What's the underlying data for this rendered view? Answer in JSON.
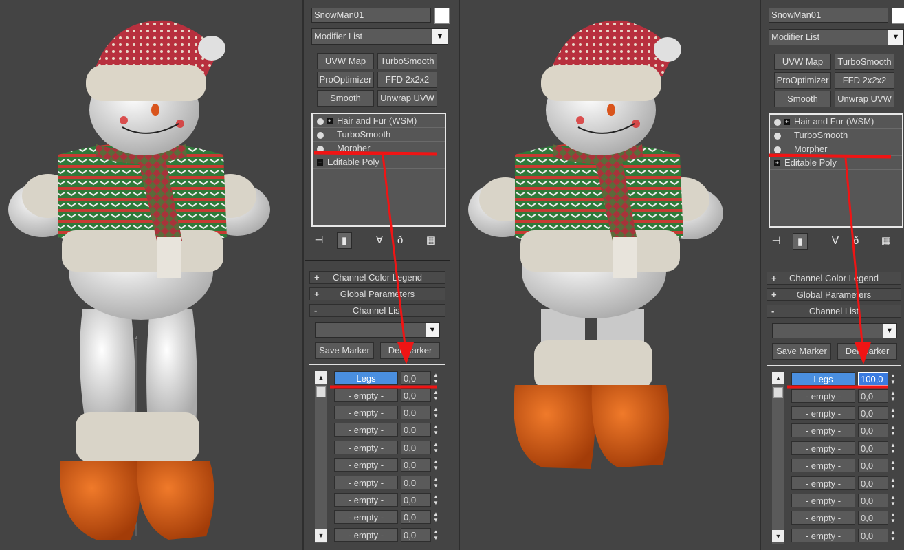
{
  "left": {
    "object_name": "SnowMan01",
    "modifier_list": "Modifier List",
    "buttons": [
      "UVW Map",
      "TurboSmooth",
      "ProOptimizer",
      "FFD 2x2x2",
      "Smooth",
      "Unwrap UVW"
    ],
    "stack": [
      "Hair and Fur (WSM)",
      "TurboSmooth",
      "Morpher",
      "Editable Poly"
    ],
    "rollouts": {
      "legend": "Channel Color Legend",
      "global": "Global Parameters",
      "channel": "Channel List"
    },
    "save_marker": "Save Marker",
    "del_marker": "Del Marker",
    "channels": [
      {
        "name": "Legs",
        "value": "0,0"
      },
      {
        "name": "- empty -",
        "value": "0,0"
      },
      {
        "name": "- empty -",
        "value": "0,0"
      },
      {
        "name": "- empty -",
        "value": "0,0"
      },
      {
        "name": "- empty -",
        "value": "0,0"
      },
      {
        "name": "- empty -",
        "value": "0,0"
      },
      {
        "name": "- empty -",
        "value": "0,0"
      },
      {
        "name": "- empty -",
        "value": "0,0"
      },
      {
        "name": "- empty -",
        "value": "0,0"
      },
      {
        "name": "- empty -",
        "value": "0,0"
      }
    ]
  },
  "right": {
    "object_name": "SnowMan01",
    "modifier_list": "Modifier List",
    "buttons": [
      "UVW Map",
      "TurboSmooth",
      "ProOptimizer",
      "FFD 2x2x2",
      "Smooth",
      "Unwrap UVW"
    ],
    "stack": [
      "Hair and Fur (WSM)",
      "TurboSmooth",
      "Morpher",
      "Editable Poly"
    ],
    "rollouts": {
      "legend": "Channel Color Legend",
      "global": "Global Parameters",
      "channel": "Channel List"
    },
    "save_marker": "Save Marker",
    "del_marker": "Del Marker",
    "channels": [
      {
        "name": "Legs",
        "value": "100,0"
      },
      {
        "name": "- empty -",
        "value": "0,0"
      },
      {
        "name": "- empty -",
        "value": "0,0"
      },
      {
        "name": "- empty -",
        "value": "0,0"
      },
      {
        "name": "- empty -",
        "value": "0,0"
      },
      {
        "name": "- empty -",
        "value": "0,0"
      },
      {
        "name": "- empty -",
        "value": "0,0"
      },
      {
        "name": "- empty -",
        "value": "0,0"
      },
      {
        "name": "- empty -",
        "value": "0,0"
      },
      {
        "name": "- empty -",
        "value": "0,0"
      }
    ]
  },
  "colors": {
    "annotation": "#f01414",
    "active_channel": "#4a8fe0",
    "viewport_bg": "#444444"
  },
  "icons": [
    "pin-icon",
    "show-end-result-icon",
    "make-unique-icon",
    "remove-modifier-icon",
    "configure-modifier-sets-icon"
  ]
}
